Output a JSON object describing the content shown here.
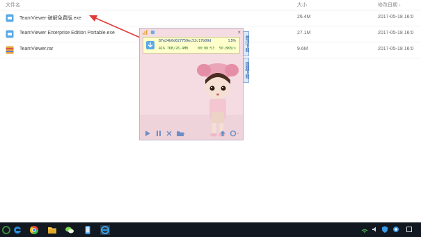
{
  "file_list": {
    "header": {
      "name": "文件名",
      "size": "大小",
      "date": "修改日期 ↓"
    },
    "rows": [
      {
        "name": "TeamViewer-破解免费版.exe",
        "size": "26.4M",
        "date": "2017-05-18 16:0",
        "icon": "exe-file-icon",
        "icon_color": "#5aa9e6"
      },
      {
        "name": "TeamViewer Enterprise Edition Portable.exe",
        "size": "27.1M",
        "date": "2017-05-18 16:0",
        "icon": "exe-file-icon",
        "icon_color": "#5aa9e6"
      },
      {
        "name": "TeamViewer.rar",
        "size": "9.6M",
        "date": "2017-05-18 16:0",
        "icon": "rar-archive-icon",
        "icon_color": "#d9534f"
      }
    ]
  },
  "annotation_arrow": {
    "color": "#e03a3a"
  },
  "download_widget": {
    "item": {
      "hash": "87e24b0d027759ec52c17b09d",
      "percent": "1.5%",
      "progress": "416.7KB/26.4MB",
      "time": "00:08:53",
      "speed": "50.8KB/s"
    },
    "side_tabs": [
      "悬浮下载",
      "隐藏下载"
    ],
    "close_glyph": "×",
    "bottom_icons": [
      "play-icon",
      "pause-icon",
      "delete-icon",
      "folder-icon",
      "upload-icon",
      "settings-icon"
    ]
  },
  "taskbar": {
    "apps": [
      "start-icon",
      "edge-browser-icon",
      "chrome-icon",
      "file-explorer-icon",
      "wechat-icon",
      "phone-icon",
      "ie-browser-icon"
    ],
    "tray": [
      "wifi-icon",
      "sound-icon",
      "shield-icon",
      "input-icon",
      "notification-icon"
    ]
  },
  "colors": {
    "accent": "#5aa9e6",
    "widget_bg": "#f4dce2",
    "taskbar_bg": "#121820"
  }
}
